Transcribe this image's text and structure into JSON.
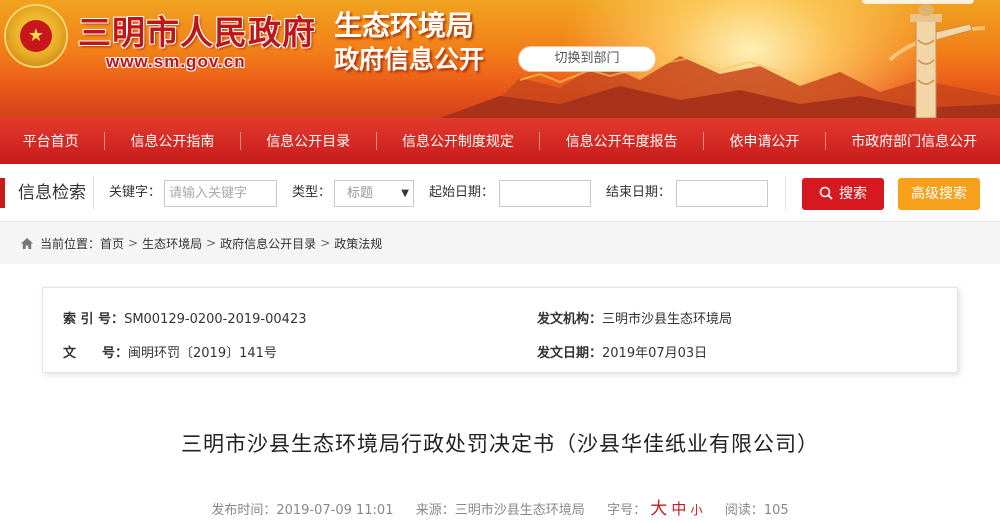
{
  "header": {
    "site_name": "三明市人民政府",
    "site_url": "www.sm.gov.cn",
    "dept_name": "生态环境局",
    "dept_subtitle": "政府信息公开",
    "switch_dept": "切换到部门",
    "emblem_glyph": "★"
  },
  "nav": {
    "items": [
      "平台首页",
      "信息公开指南",
      "信息公开目录",
      "信息公开制度规定",
      "信息公开年度报告",
      "依申请公开",
      "市政府部门信息公开"
    ]
  },
  "search": {
    "title": "信息检索",
    "keyword_label": "关键字：",
    "keyword_placeholder": "请输入关键字",
    "type_label": "类型：",
    "type_value": "标题",
    "start_label": "起始日期：",
    "end_label": "结束日期：",
    "search_button": "搜索",
    "advanced_button": "高级搜索"
  },
  "breadcrumb": {
    "prefix": "当前位置：",
    "items": [
      "首页",
      "生态环境局",
      "政府信息公开目录",
      "政策法规"
    ]
  },
  "info": {
    "index_label": "索 引 号：",
    "index_value": "SM00129-0200-2019-00423",
    "doc_label": "文　　号：",
    "doc_value": "闽明环罚〔2019〕141号",
    "org_label": "发文机构：",
    "org_value": "三明市沙县生态环境局",
    "date_label": "发文日期：",
    "date_value": "2019年07月03日"
  },
  "article": {
    "title": "三明市沙县生态环境局行政处罚决定书（沙县华佳纸业有限公司）",
    "publish_label": "发布时间：",
    "publish_value": "2019-07-09 11:01",
    "source_label": "来源：",
    "source_value": "三明市沙县生态环境局",
    "fontsize_label": "字号：",
    "fontsize_large": "大",
    "fontsize_medium": "中",
    "fontsize_small": "小",
    "reads_label": "阅读：",
    "reads_value": "105"
  },
  "colors": {
    "primary_red": "#c81b1b",
    "search_red": "#d6191f",
    "advanced_orange": "#f7a01c"
  }
}
